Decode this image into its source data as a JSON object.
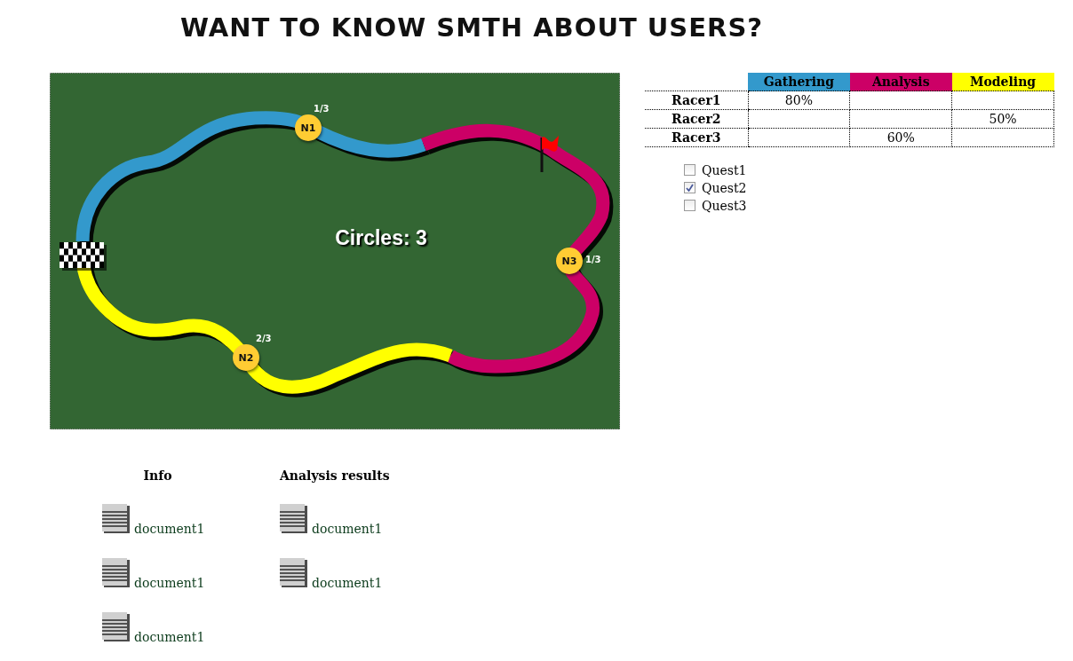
{
  "title": "WANT TO KNOW SMTH ABOUT USERS?",
  "race_map": {
    "circles_label": "Circles: 3",
    "nodes": [
      {
        "label": "N1",
        "progress": "1/3"
      },
      {
        "label": "N2",
        "progress": "2/3"
      },
      {
        "label": "N3",
        "progress": "1/3"
      }
    ]
  },
  "table": {
    "columns": [
      {
        "label": "Gathering",
        "color": "#3399cc"
      },
      {
        "label": "Analysis",
        "color": "#cc0066"
      },
      {
        "label": "Modeling",
        "color": "#ffff00"
      }
    ],
    "rows": [
      {
        "racer": "Racer1",
        "cells": [
          "80%",
          null,
          null
        ]
      },
      {
        "racer": "Racer2",
        "cells": [
          null,
          null,
          "50%"
        ]
      },
      {
        "racer": "Racer3",
        "cells": [
          null,
          "60%",
          null
        ]
      }
    ]
  },
  "quests": [
    {
      "label": "Quest1",
      "checked": false
    },
    {
      "label": "Quest2",
      "checked": true
    },
    {
      "label": "Quest3",
      "checked": false
    }
  ],
  "sections": [
    {
      "heading": "Info",
      "documents": [
        "document1",
        "document1",
        "document1"
      ]
    },
    {
      "heading": "Analysis results",
      "documents": [
        "document1",
        "document1"
      ]
    }
  ]
}
